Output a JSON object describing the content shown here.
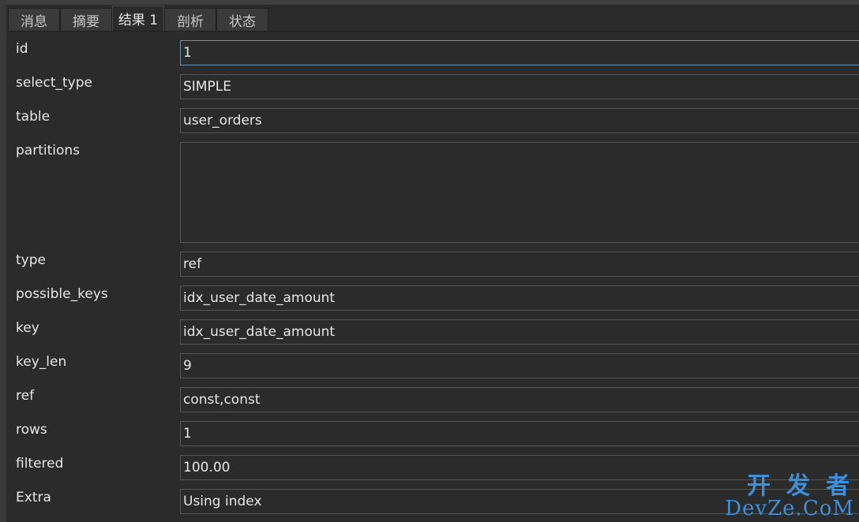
{
  "tabs": [
    {
      "label": "消息"
    },
    {
      "label": "摘要"
    },
    {
      "label": "结果 1"
    },
    {
      "label": "剖析"
    },
    {
      "label": "状态"
    }
  ],
  "fields": {
    "id": {
      "label": "id",
      "value": "1"
    },
    "select_type": {
      "label": "select_type",
      "value": "SIMPLE"
    },
    "table": {
      "label": "table",
      "value": "user_orders"
    },
    "partitions": {
      "label": "partitions",
      "value": ""
    },
    "type": {
      "label": "type",
      "value": "ref"
    },
    "possible_keys": {
      "label": "possible_keys",
      "value": "idx_user_date_amount"
    },
    "key": {
      "label": "key",
      "value": "idx_user_date_amount"
    },
    "key_len": {
      "label": "key_len",
      "value": "9"
    },
    "ref": {
      "label": "ref",
      "value": "const,const"
    },
    "rows": {
      "label": "rows",
      "value": "1"
    },
    "filtered": {
      "label": "filtered",
      "value": "100.00"
    },
    "extra": {
      "label": "Extra",
      "value": "Using index"
    }
  },
  "watermark": {
    "line1": "开发者",
    "line2": "DevZe.CoM"
  },
  "colors": {
    "background": "#2b2b2b",
    "text": "#e6e6e6",
    "watermark": "#3e8ed8"
  }
}
